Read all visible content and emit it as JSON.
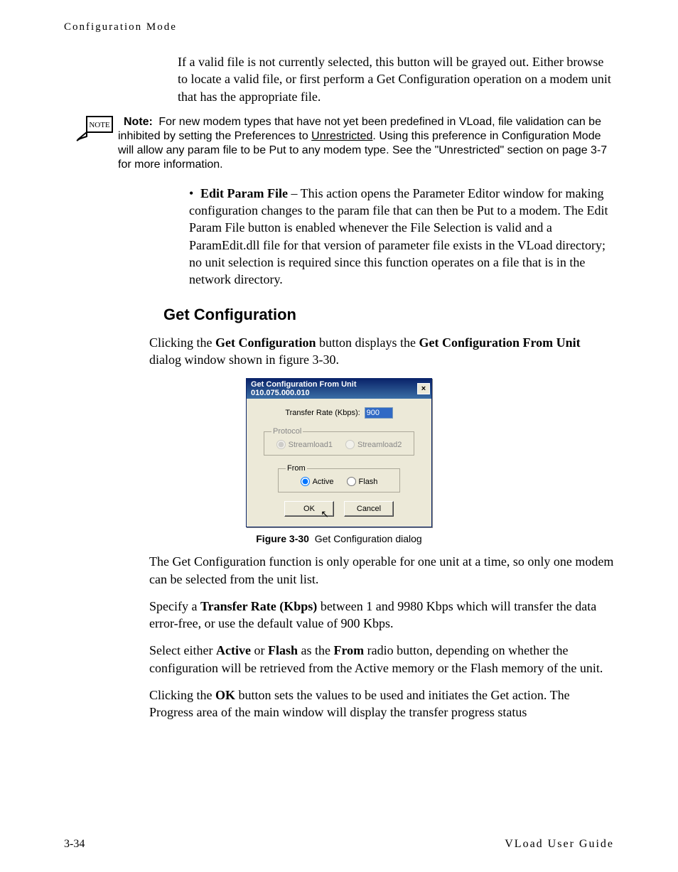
{
  "header": {
    "section": "Configuration Mode"
  },
  "intro": {
    "p1": "If a valid file is not currently selected, this button will be grayed out. Either browse to locate a valid file, or first perform a Get Configuration operation on a modem unit that has the appropriate file."
  },
  "note": {
    "icon_label": "NOTE",
    "label": "Note:",
    "text_pre": "For new modem types that have not yet been predefined in VLoad, file validation can be inhibited by setting the Preferences to ",
    "underlined": "Unrestricted",
    "text_post": ". Using this preference in Configuration Mode will allow any param file to be Put to any modem type. See the \"Unrestricted\" section on page 3-7 for more information."
  },
  "bullet": {
    "lead": "Edit Param File",
    "rest": " – This action opens the Parameter Editor window for making configuration changes to the param file that can then be Put to a modem. The Edit Param File button is enabled whenever the File Selection is valid and a ParamEdit.dll file for that version of parameter file exists in the VLoad directory; no unit selection is required since this function operates on a file that is in the network directory."
  },
  "heading": "Get Configuration",
  "p_click_pre": "Clicking the ",
  "p_click_b1": "Get Configuration",
  "p_click_mid": " button displays the ",
  "p_click_b2": "Get Configuration From Unit",
  "p_click_post": " dialog window shown in figure 3-30.",
  "dialog": {
    "title": "Get Configuration From Unit 010.075.000.010",
    "close": "×",
    "rate_label": "Transfer Rate (Kbps):",
    "rate_value": "900",
    "protocol": {
      "legend": "Protocol",
      "opt1": "Streamload1",
      "opt1_checked": true,
      "opt2": "Streamload2",
      "opt2_checked": false
    },
    "from": {
      "legend": "From",
      "opt1": "Active",
      "opt1_checked": true,
      "opt2": "Flash",
      "opt2_checked": false
    },
    "ok": "OK",
    "cancel": "Cancel"
  },
  "figure": {
    "num": "Figure 3-30",
    "caption": "Get Configuration dialog"
  },
  "p_after1": "The Get Configuration function is only operable for one unit at a time, so only one modem can be selected from the unit list.",
  "p_after2_pre": "Specify a ",
  "p_after2_b": "Transfer Rate (Kbps)",
  "p_after2_post": " between 1 and 9980 Kbps which will transfer the data error-free, or use the default value of 900 Kbps.",
  "p_after3_pre": "Select either ",
  "p_after3_b1": "Active",
  "p_after3_mid1": " or ",
  "p_after3_b2": "Flash",
  "p_after3_mid2": " as the ",
  "p_after3_b3": "From",
  "p_after3_post": " radio button, depending on whether the configuration will be retrieved from the Active memory or the Flash memory of the unit.",
  "p_after4_pre": "Clicking the ",
  "p_after4_b": "OK",
  "p_after4_post": " button sets the values to be used and initiates the Get action. The Progress area of the main window will display the transfer progress status",
  "footer": {
    "page": "3-34",
    "doc": "VLoad User Guide"
  }
}
